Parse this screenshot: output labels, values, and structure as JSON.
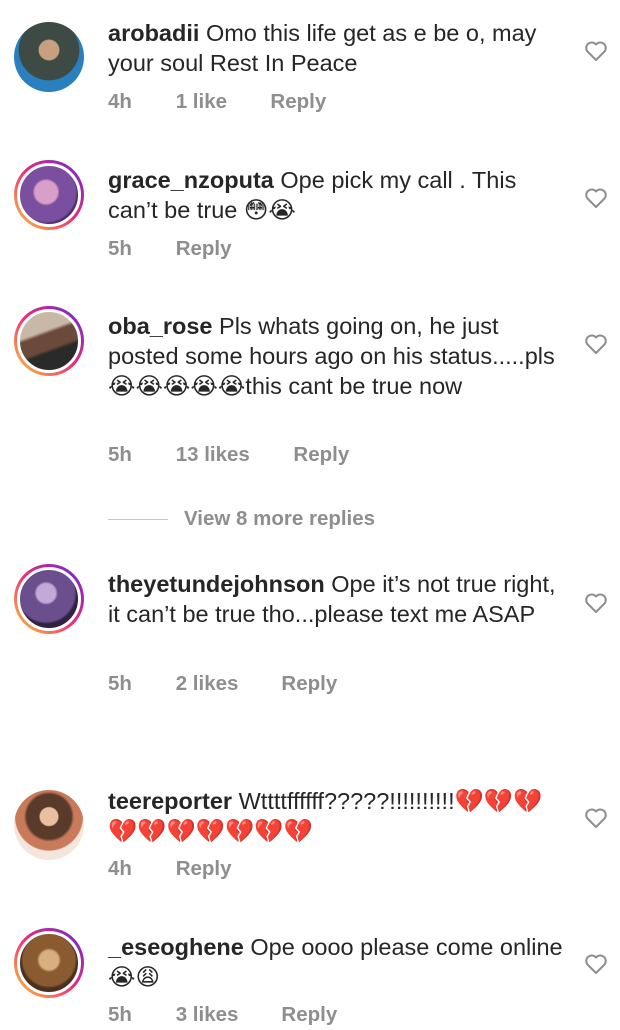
{
  "comments": [
    {
      "user": "arobadii",
      "text": "Omo this life get as e be o, may your soul Rest In Peace",
      "time": "4h",
      "likes": "1 like",
      "reply": "Reply",
      "avatar_colors": [
        "#4a5a4e",
        "#2a7fbf"
      ]
    },
    {
      "user": "grace_nzoputa",
      "text": "Ope pick my call . This can’t be true 😳😭",
      "time": "5h",
      "likes": "",
      "reply": "Reply",
      "avatar_colors": [
        "#7b4fa0",
        "#c9a2d8"
      ]
    },
    {
      "user": "oba_rose",
      "text": "Pls whats going on, he just posted some hours ago on his status.....pls😭😭😭😭😭this cant be true now",
      "time": "5h",
      "likes": "13 likes",
      "reply": "Reply",
      "avatar_colors": [
        "#6b4a3a",
        "#c7b8a8"
      ]
    },
    {
      "user": "theyetundejohnson",
      "text": "Ope it’s not true right, it can’t be true tho...please text me ASAP",
      "time": "5h",
      "likes": "2 likes",
      "reply": "Reply",
      "avatar_colors": [
        "#4d3e6e",
        "#9a84c4"
      ]
    },
    {
      "user": "teereporter",
      "text": "Wttttffffff?????!!!!!!!!!!💔💔💔💔💔💔💔💔💔💔",
      "time": "4h",
      "likes": "",
      "reply": "Reply",
      "avatar_colors": [
        "#6e4a3a",
        "#e0b8a0"
      ]
    },
    {
      "user": "_eseoghene",
      "text": "Ope oooo please come online😭😩",
      "time": "5h",
      "likes": "3 likes",
      "reply": "Reply",
      "avatar_colors": [
        "#7a5a3a",
        "#c9a070"
      ]
    }
  ],
  "view_more": "View 8 more replies",
  "colors": {
    "meta": "#8e8e8e",
    "text": "#262626",
    "story_ring": "#d6249f"
  }
}
